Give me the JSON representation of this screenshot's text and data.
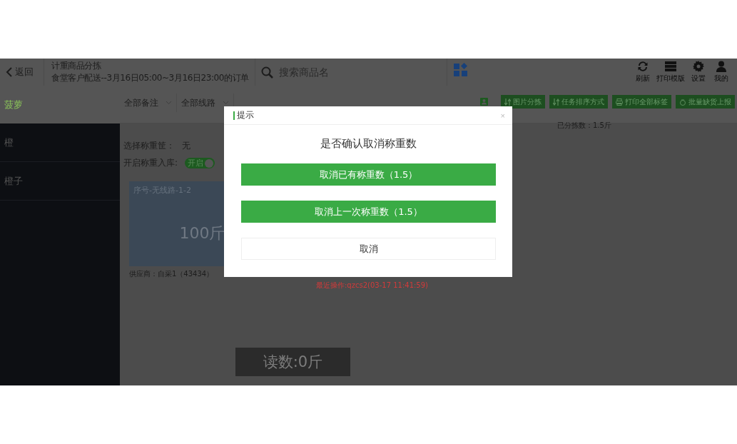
{
  "header": {
    "back": "返回",
    "title": "计重商品分拣",
    "subtitle": "食堂客户配送--3月16日05:00~3月16日23:00的订单",
    "search": {
      "placeholder": "搜索商品名"
    },
    "actions": [
      {
        "label": "刷新"
      },
      {
        "label": "打印模版"
      },
      {
        "label": "设置"
      },
      {
        "label": "我的"
      }
    ]
  },
  "sidebar": {
    "items": [
      {
        "label": "菠萝",
        "selected": true
      },
      {
        "label": "橙",
        "selected": false
      },
      {
        "label": "橙子",
        "selected": false
      }
    ]
  },
  "filters": [
    "全部备注",
    "全部线路"
  ],
  "toolbar": [
    {
      "label": "图片分拣"
    },
    {
      "label": "任务排序方式"
    },
    {
      "label": "打印全部标签"
    },
    {
      "label": "批量缺货上报"
    }
  ],
  "sorted_count": "已分拣数：1.5斤",
  "basket": {
    "label": "选择称重筐：",
    "value": "无"
  },
  "weigh_in": {
    "label": "开启称重入库:",
    "toggle": {
      "label": "开启",
      "on": true
    }
  },
  "tasks": [
    {
      "title": "序号-无线路-1-2",
      "amount": "100斤",
      "supplier": "供应商：自采1（43434）"
    },
    {
      "last_operation": "最近操作:qzcs2(03-17 11:41:59)"
    }
  ],
  "reading": "读数:0斤",
  "dialog": {
    "title": "提示",
    "close": "×",
    "message": "是否确认取消称重数",
    "buttons": [
      {
        "label": "取消已有称重数（1.5）",
        "kind": "primary"
      },
      {
        "label": "取消上一次称重数（1.5）",
        "kind": "primary"
      },
      {
        "label": "取消",
        "kind": "default"
      }
    ]
  }
}
